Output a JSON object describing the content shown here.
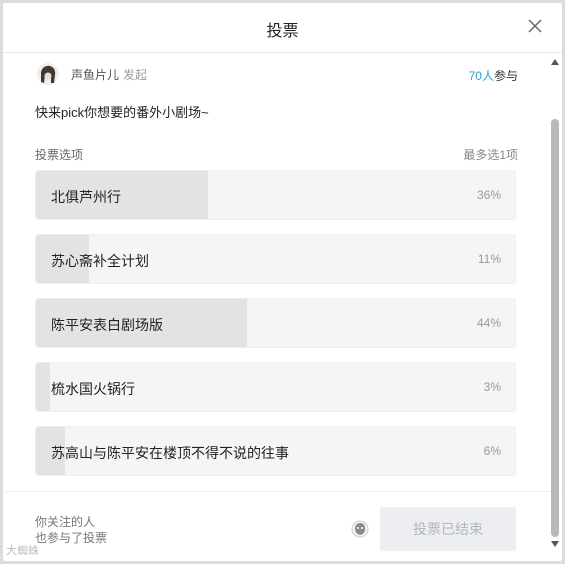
{
  "modal": {
    "title": "投票"
  },
  "vote": {
    "author": "声鱼片儿",
    "author_suffix": "发起",
    "participant_count": "70人",
    "participant_suffix": "参与",
    "question": "快来pick你想要的番外小剧场~",
    "options_label": "投票选项",
    "max_choice": "最多选1项",
    "options": [
      {
        "label": "北俱芦州行",
        "percent": "36%",
        "value": 0.36
      },
      {
        "label": "苏心斋补全计划",
        "percent": "11%",
        "value": 0.11
      },
      {
        "label": "陈平安表白剧场版",
        "percent": "44%",
        "value": 0.44
      },
      {
        "label": "梳水国火锅行",
        "percent": "3%",
        "value": 0.03
      },
      {
        "label": "苏高山与陈平安在楼顶不得不说的往事",
        "percent": "6%",
        "value": 0.06
      }
    ]
  },
  "footer": {
    "friends_line1": "你关注的人",
    "friends_line2": "也参与了投票",
    "vote_button": "投票已结束"
  },
  "watermark": "大蜘蛛",
  "colors": {
    "accent": "#2aa0d8",
    "fill": "#e2e3e5",
    "option_bg": "#f4f5f7"
  },
  "icons": {
    "close": "close-icon",
    "avatar": "avatar",
    "scroll_up": "scroll-up-arrow",
    "scroll_down": "scroll-down-arrow"
  }
}
